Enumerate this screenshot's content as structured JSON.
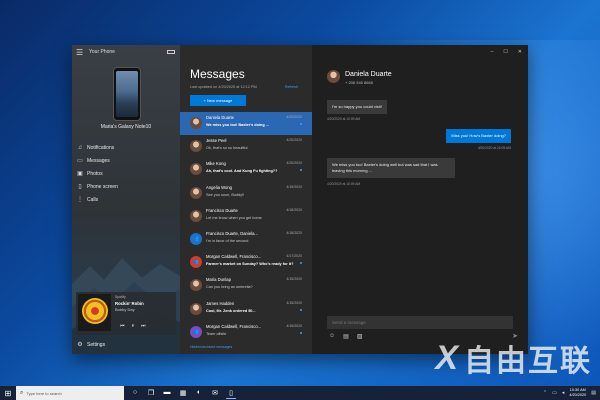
{
  "app": {
    "title": "Your Phone",
    "device_name": "Maria's Galaxy Note10"
  },
  "nav": [
    {
      "label": "Notifications",
      "icon": "bell-icon"
    },
    {
      "label": "Messages",
      "icon": "chat-icon"
    },
    {
      "label": "Photos",
      "icon": "photos-icon"
    },
    {
      "label": "Phone screen",
      "icon": "phone-screen-icon"
    },
    {
      "label": "Calls",
      "icon": "phone-icon"
    }
  ],
  "media": {
    "app": "Spotify",
    "song": "Rockin' Robin",
    "artist": "Bobby Day"
  },
  "settings_label": "Settings",
  "messages": {
    "title": "Messages",
    "updated": "Last updated on 4/20/2020 at 12:12 PM",
    "refresh": "Refresh",
    "new_message": "+ New message",
    "footer": "Hidden/archived messages"
  },
  "conversations": [
    {
      "name": "Daniela Duarte",
      "date": "4/20/2020",
      "preview": "We miss you too! Baxter's doing ...",
      "bold": true,
      "unread": true,
      "active": true,
      "avatar": "person"
    },
    {
      "name": "Jesse Peel",
      "date": "4/20/2020",
      "preview": "Ok, that's so so beautiful",
      "bold": false,
      "unread": false,
      "active": false,
      "avatar": "person"
    },
    {
      "name": "Mike Kong",
      "date": "4/20/2020",
      "preview": "Ah, that's cool. And Kung Fu fighting??",
      "bold": true,
      "unread": true,
      "active": false,
      "avatar": "person"
    },
    {
      "name": "Angelia Wong",
      "date": "4/19/2020",
      "preview": "See you soon, Buddy!!",
      "bold": false,
      "unread": false,
      "active": false,
      "avatar": "person"
    },
    {
      "name": "Francisco Duarte",
      "date": "4/18/2020",
      "preview": "Let me know when you get home",
      "bold": false,
      "unread": false,
      "active": false,
      "avatar": "person"
    },
    {
      "name": "Francisco Duarte, Daniela...",
      "date": "4/18/2020",
      "preview": "I'm in favor of the second",
      "bold": false,
      "unread": false,
      "active": false,
      "avatar": "group"
    },
    {
      "name": "Morgan Caldwell, Francisco...",
      "date": "4/17/2020",
      "preview": "Farmer's market on Sunday? Who's ready for it?",
      "bold": true,
      "unread": true,
      "active": false,
      "avatar": "group-red"
    },
    {
      "name": "Maria Dunlap",
      "date": "4/15/2020",
      "preview": "Can you bring an umbrella?",
      "bold": false,
      "unread": false,
      "active": false,
      "avatar": "person"
    },
    {
      "name": "James Hadden",
      "date": "4/15/2020",
      "preview": "Cool, Mr. Zenk ordered 50...",
      "bold": true,
      "unread": true,
      "active": false,
      "avatar": "person"
    },
    {
      "name": "Morgan Caldwell, Francisco...",
      "date": "4/15/2020",
      "preview": "Team offsite",
      "bold": false,
      "unread": true,
      "active": false,
      "avatar": "group-purple"
    }
  ],
  "chat": {
    "contact": "Daniela Duarte",
    "phone": "+ 206 545 8665",
    "bubbles": [
      {
        "dir": "in",
        "text": "I'm so happy you could visit!",
        "time": "4/20/2020 at 10:09 AM"
      },
      {
        "dir": "out",
        "text": "Miss you! How's Baxter doing?",
        "time": "4/20/2020 at 10:09 AM"
      },
      {
        "dir": "in",
        "text": "We miss you too! Baxter's doing well but was sad that I was leaving this morning ...",
        "time": "4/20/2020 at 10:09 AM"
      }
    ],
    "input_placeholder": "Send a message"
  },
  "taskbar": {
    "search_placeholder": "Type here to search",
    "time": "10:30 AM",
    "date": "4/20/2020"
  },
  "watermark": {
    "mark": "X",
    "text": "自由互联"
  }
}
